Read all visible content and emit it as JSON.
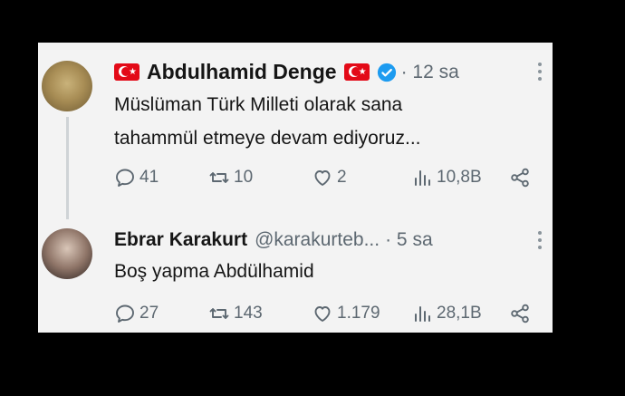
{
  "tweets": [
    {
      "name": "Abdulhamid Denge",
      "time": "· 12 sa",
      "text_lines": [
        "Müslüman Türk Milleti olarak sana",
        "tahammül etmeye devam ediyoruz..."
      ],
      "replies": "41",
      "retweets": "10",
      "likes": "2",
      "views": "10,8B",
      "verified": true,
      "icon": "turkish-flag"
    },
    {
      "name": "Ebrar Karakurt",
      "handle": "@karakurteb...",
      "time": "· 5 sa",
      "text": "Boş yapma Abdülhamid",
      "replies": "27",
      "retweets": "143",
      "likes": "1.179",
      "views": "28,1B"
    }
  ],
  "colors": {
    "card": "#f3f3f3",
    "text": "#151515",
    "muted": "#5d6871",
    "verified": "#1d9bf0",
    "flag": "#e30a17"
  }
}
